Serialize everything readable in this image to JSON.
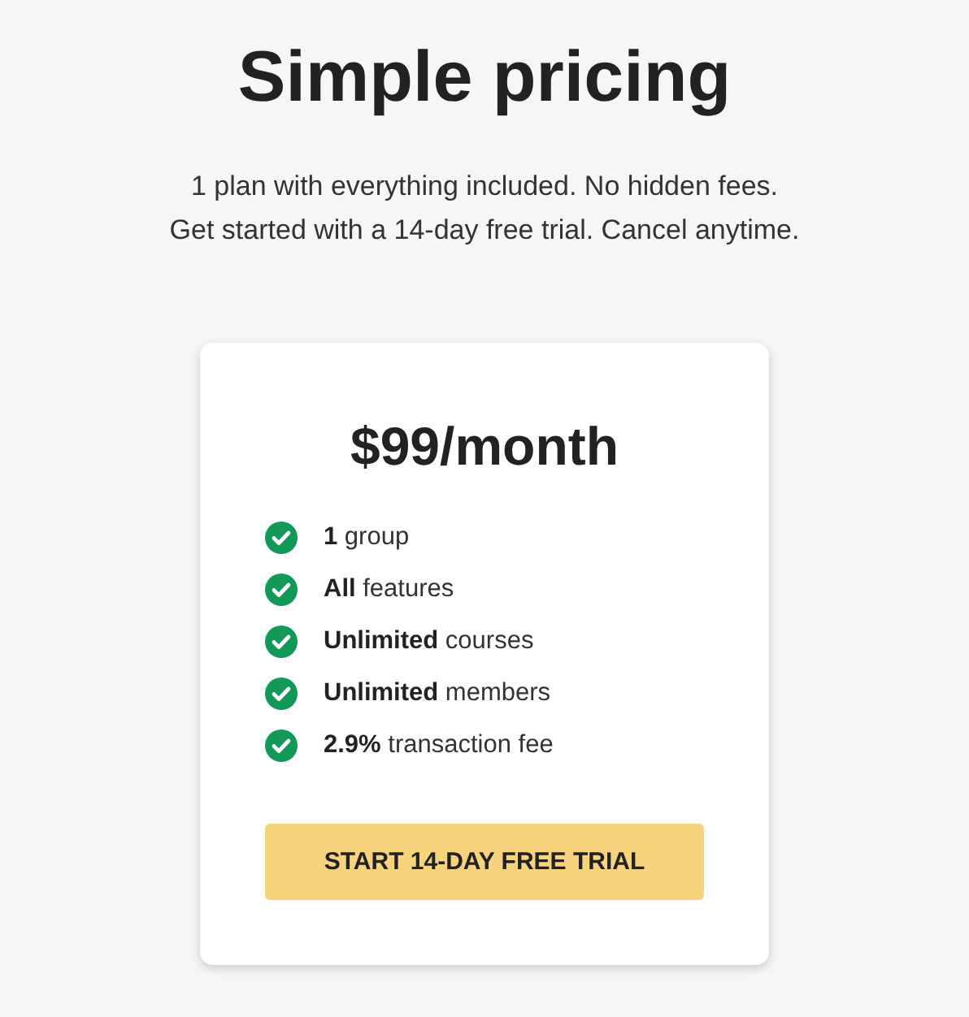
{
  "title": "Simple pricing",
  "subtitle": [
    "1 plan with everything included. No hidden fees.",
    "Get started with a 14-day free trial. Cancel anytime."
  ],
  "plan": {
    "price": "$99/month",
    "features": [
      {
        "text": "**1** group",
        "checked": true
      },
      {
        "text": "**All** features",
        "checked": true
      },
      {
        "text": "**Unlimited** courses",
        "checked": true
      },
      {
        "text": "**Unlimited** members",
        "checked": true
      },
      {
        "text": "**2.9%** transaction fee",
        "checked": true
      }
    ],
    "button": "START 14-DAY FREE TRIAL"
  }
}
